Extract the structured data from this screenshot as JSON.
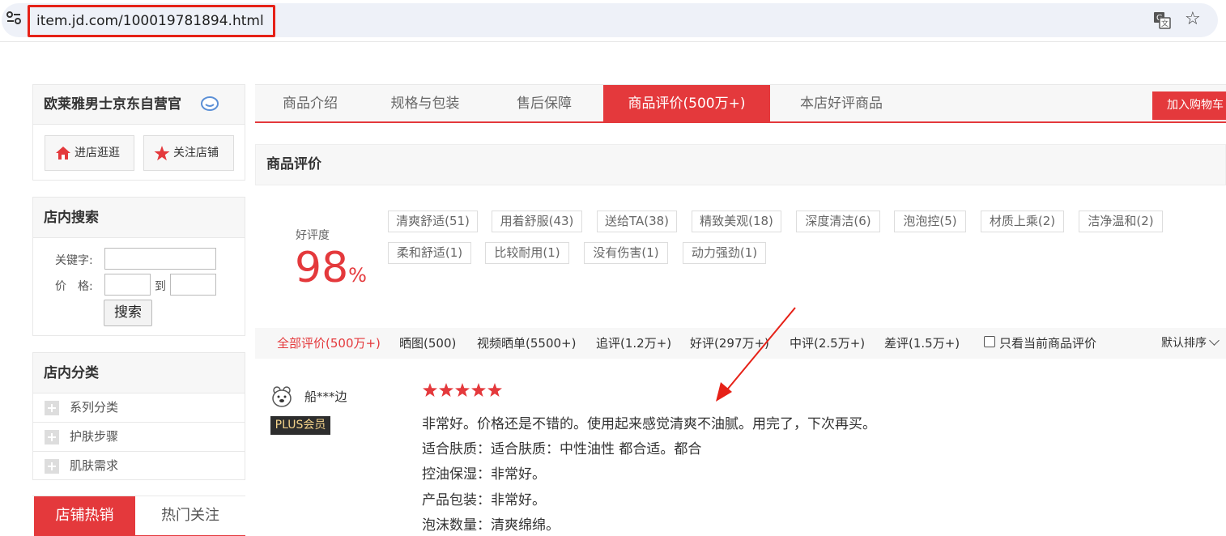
{
  "browser": {
    "url": "item.jd.com/100019781894.html"
  },
  "sidebar": {
    "shop_name": "欧莱雅男士京东自营官",
    "enter_shop": "进店逛逛",
    "follow_shop": "关注店铺",
    "search": {
      "title": "店内搜索",
      "keyword_label": "关键字:",
      "price_label": "价　格:",
      "to_label": "到",
      "button": "搜索"
    },
    "categories": {
      "title": "店内分类",
      "items": [
        "系列分类",
        "护肤步骤",
        "肌肤需求"
      ]
    },
    "hot_tabs": [
      "店铺热销",
      "热门关注"
    ]
  },
  "tabs": {
    "items": [
      "商品介绍",
      "规格与包装",
      "售后保障",
      "商品评价(500万+)",
      "本店好评商品"
    ],
    "add_to_cart": "加入购物车"
  },
  "reviews": {
    "section_title": "商品评价",
    "rate_label": "好评度",
    "rate_value": "98",
    "rate_unit": "%",
    "tags": [
      "清爽舒适(51)",
      "用着舒服(43)",
      "送给TA(38)",
      "精致美观(18)",
      "深度清洁(6)",
      "泡泡控(5)",
      "材质上乘(2)",
      "洁净温和(2)",
      "柔和舒适(1)",
      "比较耐用(1)",
      "没有伤害(1)",
      "动力强劲(1)"
    ],
    "filters": [
      "全部评价(500万+)",
      "晒图(500)",
      "视频晒单(5500+)",
      "追评(1.2万+)",
      "好评(297万+)",
      "中评(2.5万+)",
      "差评(1.5万+)"
    ],
    "only_current": "只看当前商品评价",
    "sort": "默认排序",
    "item": {
      "user": "船***边",
      "badge": "PLUS会员",
      "stars": 5,
      "lines": [
        "非常好。价格还是不错的。使用起来感觉清爽不油腻。用完了，下次再买。",
        "适合肤质：适合肤质：中性油性 都合适。都合",
        "控油保湿：非常好。",
        "产品包装：非常好。",
        "泡沫数量：清爽绵绵。"
      ]
    }
  },
  "colors": {
    "accent": "#e4393c",
    "highlight_box": "#e62117"
  }
}
